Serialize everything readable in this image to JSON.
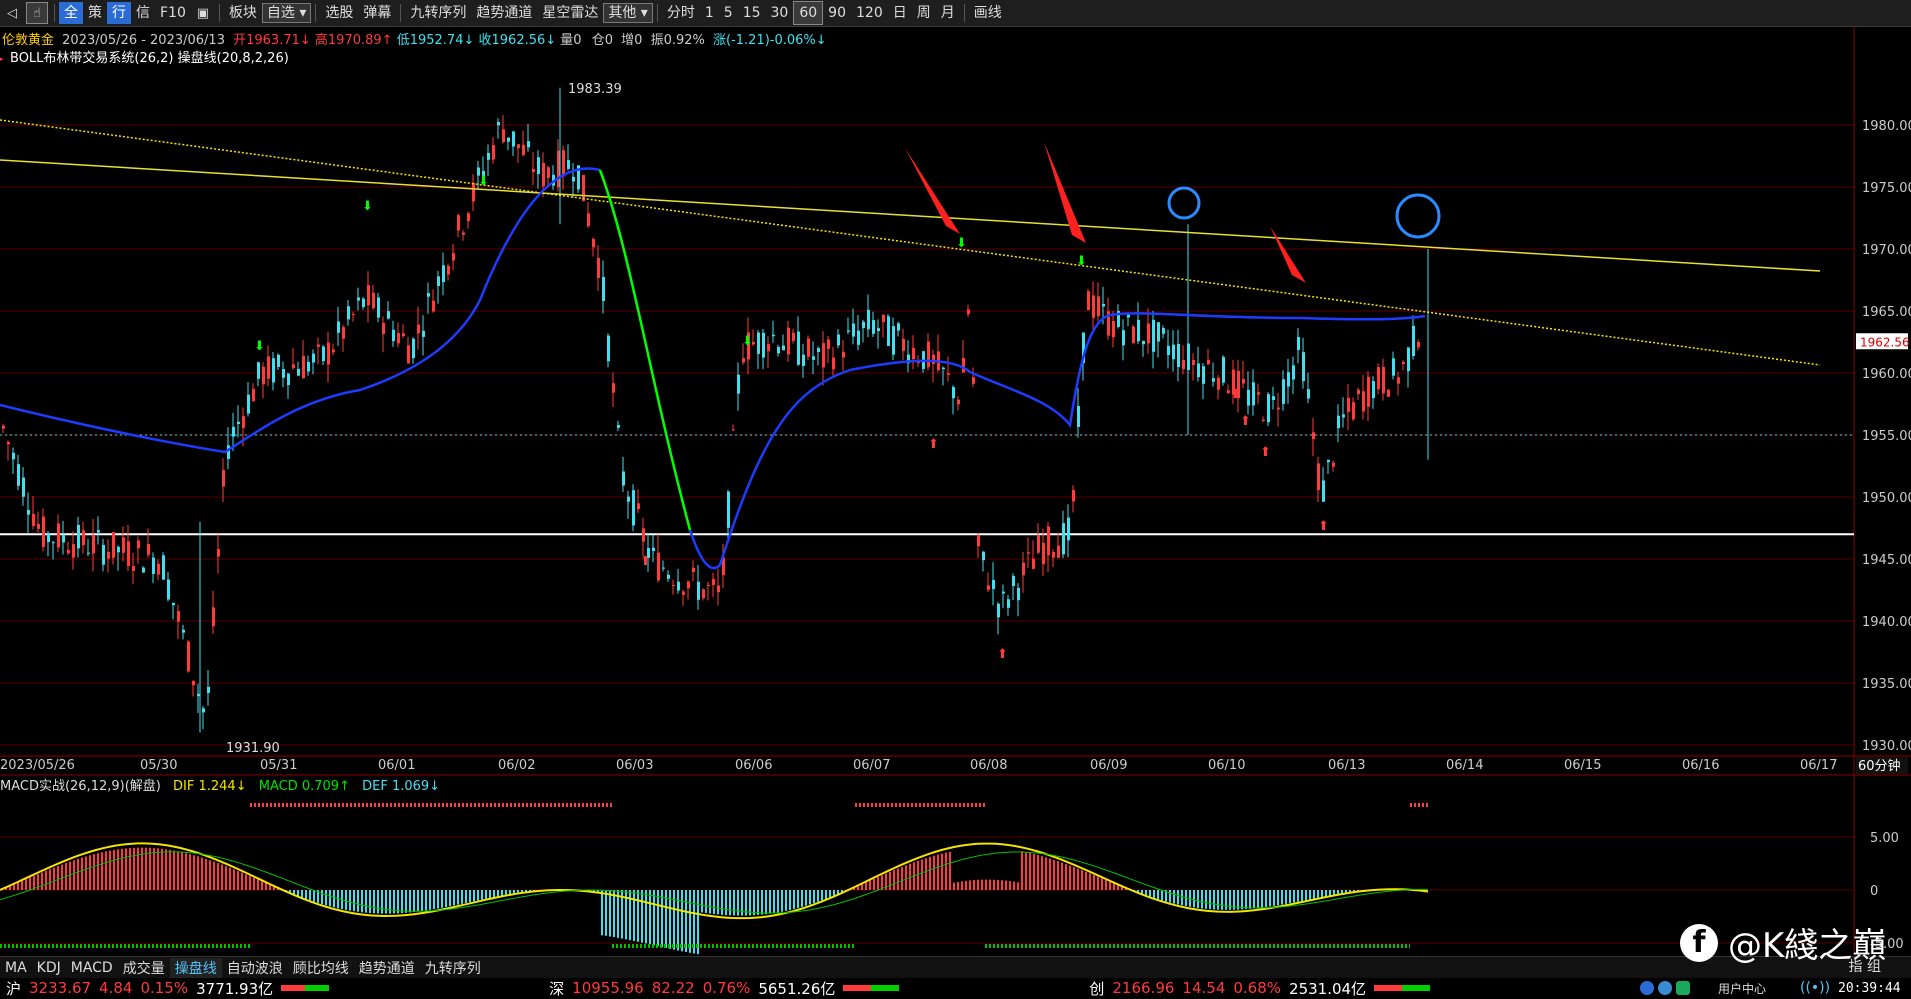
{
  "toolbar": {
    "items": [
      "全",
      "策",
      "行",
      "信",
      "F10",
      "",
      "板块",
      "自选",
      "选股",
      "弹幕",
      "九转序列",
      "趋势通道",
      "星空雷达",
      "其他",
      "分时",
      "1",
      "5",
      "15",
      "30",
      "60",
      "90",
      "120",
      "日",
      "周",
      "月",
      "画线"
    ]
  },
  "header": {
    "symbol": "伦敦黄金",
    "range": "2023/05/26 - 2023/06/13",
    "open": "开1963.71↓",
    "high": "高1970.89↑",
    "low": "低1952.74↓",
    "close": "收1962.56↓",
    "vol": "量0",
    "pos": "仓0",
    "inc": "增0",
    "amp": "振0.92%",
    "chg": "涨(-1.21)-0.06%↓",
    "indicator": "BOLL布林带交易系统(26,2)  操盘线(20,8,2,26)"
  },
  "price_axis": {
    "ticks": [
      "1980.00",
      "1975.00",
      "1970.00",
      "1965.00",
      "1960.00",
      "1955.00",
      "1950.00",
      "1945.00",
      "1940.00",
      "1935.00",
      "1930.00"
    ],
    "current": "1962.56"
  },
  "date_axis": {
    "labels": [
      "2023/05/26",
      "05/30",
      "05/31",
      "06/01",
      "06/02",
      "06/03",
      "06/06",
      "06/07",
      "06/08",
      "06/09",
      "06/10",
      "06/13",
      "06/14",
      "06/15",
      "06/16",
      "06/17"
    ],
    "period": "60分钟"
  },
  "annotations": {
    "high_label": "1983.39",
    "low_label": "1931.90"
  },
  "macd": {
    "title": "MACD实战(26,12,9)(解盘)",
    "dif": "DIF 1.244↓",
    "macd": "MACD 0.709↑",
    "def": "DEF 1.069↓",
    "ticks": [
      "5.00",
      "0",
      "-5.00"
    ]
  },
  "bottom_tabs": [
    "MA",
    "KDJ",
    "MACD",
    "成交量",
    "操盘线",
    "自动波浪",
    "顾比均线",
    "趋势通道",
    "九转序列"
  ],
  "bottom_right": "指 组",
  "status": {
    "sh": {
      "label": "沪",
      "price": "3233.67",
      "chg": "4.84",
      "pct": "0.15%",
      "amt": "3771.93亿"
    },
    "sz": {
      "label": "深",
      "price": "10955.96",
      "chg": "82.22",
      "pct": "0.76%",
      "amt": "5651.26亿"
    },
    "cy": {
      "label": "创",
      "price": "2166.96",
      "chg": "14.54",
      "pct": "0.68%",
      "amt": "2531.04亿"
    },
    "user": "用户中心",
    "time": "20:39:44"
  },
  "watermark": "@K綫之巔",
  "colors": {
    "up": "#ff3b3b",
    "down": "#40e0f0",
    "boll": "#1e3cff",
    "green": "#00ff00",
    "yellow": "#f5e400",
    "axis": "#8b0000"
  }
}
